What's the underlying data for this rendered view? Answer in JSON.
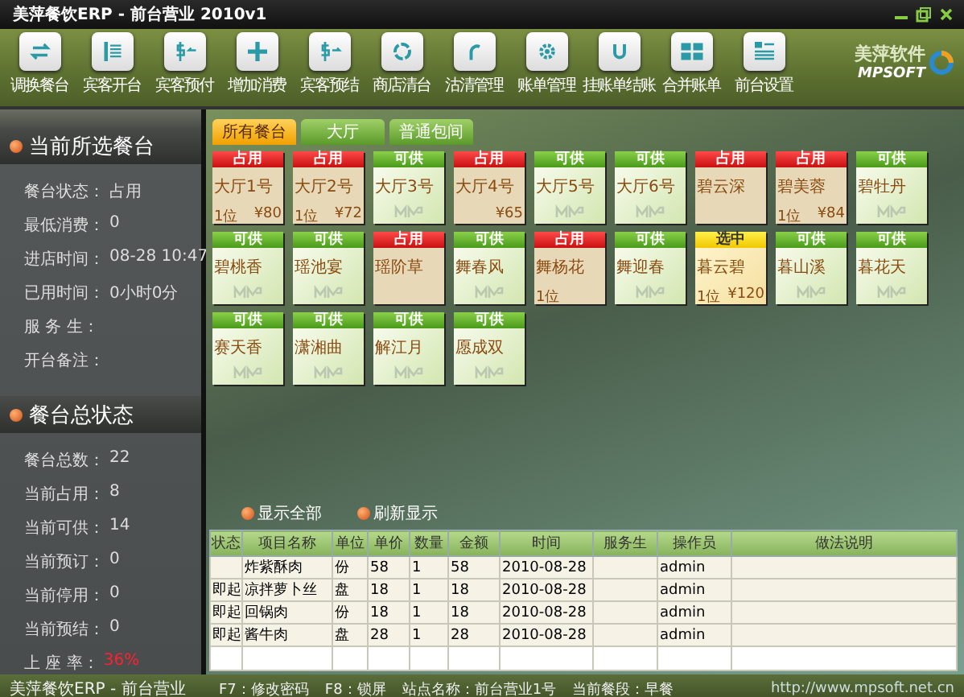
{
  "window": {
    "title": "美萍餐饮ERP - 前台营业 2010v1"
  },
  "toolbar": [
    {
      "label": "调换餐台"
    },
    {
      "label": "宾客开台"
    },
    {
      "label": "宾客预付"
    },
    {
      "label": "增加消费"
    },
    {
      "label": "宾客预结"
    },
    {
      "label": "商店清台"
    },
    {
      "label": "沽清管理"
    },
    {
      "label": "账单管理"
    },
    {
      "label": "挂账单结账"
    },
    {
      "label": "合并账单"
    },
    {
      "label": "前台设置"
    }
  ],
  "logo": {
    "name": "美萍软件",
    "sub": "MPSOFT"
  },
  "current_table": {
    "title": "当前所选餐台",
    "fields": [
      {
        "label": "餐台状态：",
        "value": "占用"
      },
      {
        "label": "最低消费：",
        "value": "0"
      },
      {
        "label": "进店时间：",
        "value": "08-28 10:47"
      },
      {
        "label": "已用时间：",
        "value": "0小时0分"
      },
      {
        "label": "服 务 生："
      },
      {
        "label": "开台备注："
      }
    ]
  },
  "overall_status": {
    "title": "餐台总状态",
    "fields": [
      {
        "label": "餐台总数：",
        "value": "22",
        "alert": false
      },
      {
        "label": "当前占用：",
        "value": "8",
        "alert": false
      },
      {
        "label": "当前可供：",
        "value": "14",
        "alert": false
      },
      {
        "label": "当前预订：",
        "value": "0",
        "alert": false
      },
      {
        "label": "当前停用：",
        "value": "0",
        "alert": false
      },
      {
        "label": "当前预结：",
        "value": "0",
        "alert": false
      },
      {
        "label": "上 座 率：",
        "value": "36%",
        "alert": true
      }
    ]
  },
  "tabs": [
    {
      "label": "所有餐台",
      "selected": true
    },
    {
      "label": "大厅",
      "selected": false
    },
    {
      "label": "普通包间",
      "selected": false
    }
  ],
  "tables": [
    {
      "name": "大厅1号",
      "kind": "occupied",
      "status_label": "占用",
      "guests": "1位",
      "amount": "¥80"
    },
    {
      "name": "大厅2号",
      "kind": "occupied",
      "status_label": "占用",
      "guests": "1位",
      "amount": "¥72"
    },
    {
      "name": "大厅3号",
      "kind": "available",
      "status_label": "可供"
    },
    {
      "name": "大厅4号",
      "kind": "occupied",
      "status_label": "占用",
      "amount": "¥65"
    },
    {
      "name": "大厅5号",
      "kind": "available",
      "status_label": "可供"
    },
    {
      "name": "大厅6号",
      "kind": "available",
      "status_label": "可供"
    },
    {
      "name": "碧云深",
      "kind": "occupied",
      "status_label": "占用"
    },
    {
      "name": "碧美蓉",
      "kind": "occupied",
      "status_label": "占用",
      "guests": "1位",
      "amount": "¥84"
    },
    {
      "name": "碧牡丹",
      "kind": "available",
      "status_label": "可供"
    },
    {
      "name": "碧桃香",
      "kind": "available",
      "status_label": "可供"
    },
    {
      "name": "瑶池宴",
      "kind": "available",
      "status_label": "可供"
    },
    {
      "name": "瑶阶草",
      "kind": "occupied",
      "status_label": "占用"
    },
    {
      "name": "舞春风",
      "kind": "available",
      "status_label": "可供"
    },
    {
      "name": "舞杨花",
      "kind": "occupied",
      "status_label": "占用",
      "guests": "1位"
    },
    {
      "name": "舞迎春",
      "kind": "available",
      "status_label": "可供"
    },
    {
      "name": "暮云碧",
      "kind": "selected",
      "status_label": "选中",
      "guests": "1位",
      "amount": "¥120"
    },
    {
      "name": "暮山溪",
      "kind": "available",
      "status_label": "可供"
    },
    {
      "name": "暮花天",
      "kind": "available",
      "status_label": "可供"
    },
    {
      "name": "赛天香",
      "kind": "available",
      "status_label": "可供"
    },
    {
      "name": "潇湘曲",
      "kind": "available",
      "status_label": "可供"
    },
    {
      "name": "解江月",
      "kind": "available",
      "status_label": "可供"
    },
    {
      "name": "愿成双",
      "kind": "available",
      "status_label": "可供"
    }
  ],
  "actions": [
    "显示全部",
    "刷新显示"
  ],
  "order_table": {
    "columns": [
      "状态",
      "项目名称",
      "单位",
      "单价",
      "数量",
      "金额",
      "时间",
      "服务生",
      "操作员",
      "做法说明"
    ],
    "rows": [
      [
        "",
        "炸紫酥肉",
        "份",
        "58",
        "1",
        "58",
        "2010-08-28",
        "",
        "admin",
        ""
      ],
      [
        "即起",
        "凉拌萝卜丝",
        "盘",
        "18",
        "1",
        "18",
        "2010-08-28",
        "",
        "admin",
        ""
      ],
      [
        "即起",
        "回锅肉",
        "份",
        "18",
        "1",
        "18",
        "2010-08-28",
        "",
        "admin",
        ""
      ],
      [
        "即起",
        "酱牛肉",
        "盘",
        "28",
        "1",
        "28",
        "2010-08-28",
        "",
        "admin",
        ""
      ]
    ]
  },
  "status_bar": [
    "美萍餐饮ERP - 前台营业",
    "F7：修改密码",
    "F8：锁屏",
    "站点名称：前台营业1号",
    "当前餐段：早餐",
    "http://www.mpsoft.net.cn"
  ]
}
